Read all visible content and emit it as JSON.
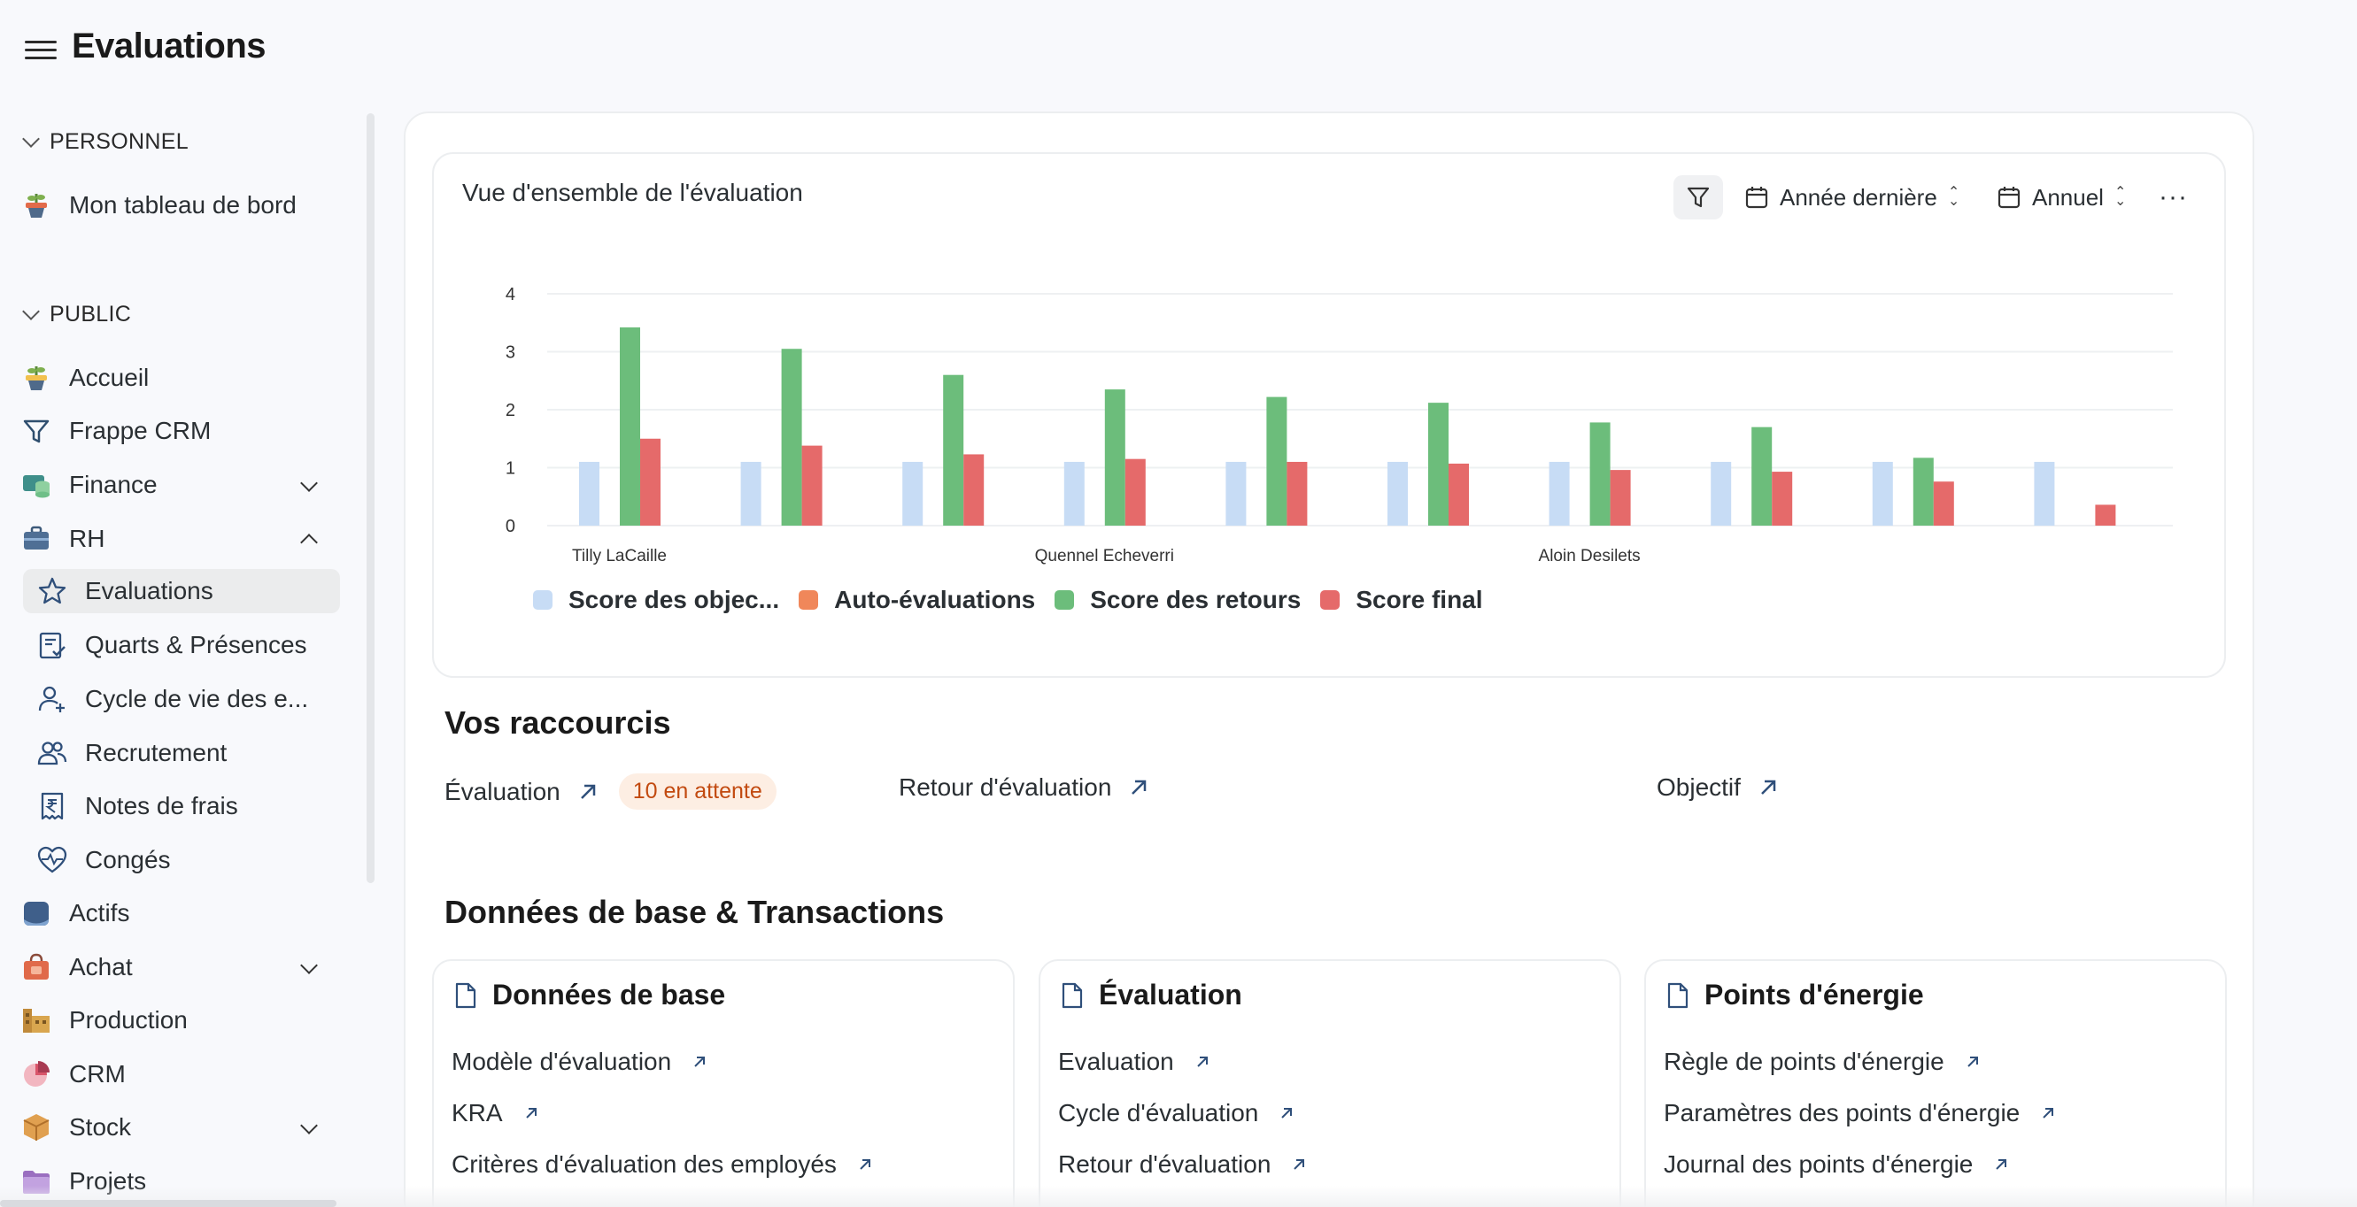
{
  "app": {
    "title": "Evaluations"
  },
  "sidebar": {
    "sections": [
      {
        "label": "PERSONNEL"
      },
      {
        "label": "PUBLIC"
      }
    ],
    "personal_items": [
      {
        "label": "Mon tableau de bord",
        "icon": "dashboard-plant-icon"
      }
    ],
    "items": [
      {
        "label": "Accueil",
        "icon": "home-plant-icon"
      },
      {
        "label": "Frappe CRM",
        "icon": "funnel-icon"
      },
      {
        "label": "Finance",
        "icon": "finance-icon",
        "expandable": true
      },
      {
        "label": "RH",
        "icon": "briefcase-icon",
        "expanded": true
      },
      {
        "label": "Evaluations",
        "icon": "star-icon",
        "active": true
      },
      {
        "label": "Quarts & Présences",
        "icon": "clipboard-check-icon"
      },
      {
        "label": "Cycle de vie des e...",
        "icon": "user-plus-icon"
      },
      {
        "label": "Recrutement",
        "icon": "users-icon"
      },
      {
        "label": "Notes de frais",
        "icon": "rupee-receipt-icon"
      },
      {
        "label": "Congés",
        "icon": "heart-pulse-icon"
      },
      {
        "label": "Actifs",
        "icon": "assets-icon"
      },
      {
        "label": "Achat",
        "icon": "shopping-bag-icon",
        "expandable": true
      },
      {
        "label": "Production",
        "icon": "factory-icon"
      },
      {
        "label": "CRM",
        "icon": "pie-chart-icon"
      },
      {
        "label": "Stock",
        "icon": "box-icon",
        "expandable": true
      },
      {
        "label": "Projets",
        "icon": "folder-icon"
      }
    ]
  },
  "chart_card": {
    "title": "Vue d'ensemble de l'évaluation",
    "controls": {
      "period": "Année dernière",
      "interval": "Annuel"
    }
  },
  "chart_data": {
    "type": "bar",
    "x_tick_labels": [
      "Tilly LaCaille",
      "Quennel Echeverri",
      "Aloin Desilets"
    ],
    "categories": [
      "1",
      "2",
      "3",
      "4",
      "5",
      "6",
      "7",
      "8",
      "9",
      "10"
    ],
    "ylim": [
      0,
      4
    ],
    "yticks": [
      0,
      1,
      2,
      3,
      4
    ],
    "grid": true,
    "legend_position": "bottom-left",
    "series": [
      {
        "name": "Score des objec...",
        "color": "#c7dcf5",
        "values": [
          1.1,
          1.1,
          1.1,
          1.1,
          1.1,
          1.1,
          1.1,
          1.1,
          1.1,
          1.1
        ]
      },
      {
        "name": "Auto-évaluations",
        "color": "#f0875a",
        "values": [
          0,
          0,
          0,
          0,
          0,
          0,
          0,
          0,
          0,
          0
        ]
      },
      {
        "name": "Score des retours",
        "color": "#6cbd7b",
        "values": [
          3.42,
          3.05,
          2.6,
          2.35,
          2.22,
          2.12,
          1.78,
          1.7,
          1.17,
          0
        ]
      },
      {
        "name": "Score final",
        "color": "#e56a6a",
        "values": [
          1.5,
          1.38,
          1.23,
          1.15,
          1.1,
          1.07,
          0.96,
          0.93,
          0.76,
          0.36
        ]
      }
    ]
  },
  "shortcuts": {
    "heading": "Vos raccourcis",
    "items": [
      {
        "label": "Évaluation",
        "badge": "10 en attente"
      },
      {
        "label": "Retour d'évaluation"
      },
      {
        "label": "Objectif"
      }
    ]
  },
  "masters": {
    "heading": "Données de base & Transactions",
    "cards": [
      {
        "title": "Données de base",
        "links": [
          "Modèle d'évaluation",
          "KRA",
          "Critères d'évaluation des employés"
        ]
      },
      {
        "title": "Évaluation",
        "links": [
          "Evaluation",
          "Cycle d'évaluation",
          "Retour d'évaluation"
        ]
      },
      {
        "title": "Points d'énergie",
        "links": [
          "Règle de points d'énergie",
          "Paramètres des points d'énergie",
          "Journal des points d'énergie"
        ]
      }
    ]
  }
}
